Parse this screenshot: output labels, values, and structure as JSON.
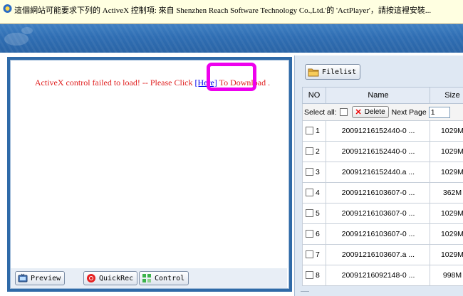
{
  "infobar": {
    "message": "這個網站可能要求下列的 ActiveX 控制項: 來自 Shenzhen Reach Software Technology Co.,Ltd.'的 'ActPlayer'，請按這裡安裝..."
  },
  "player": {
    "msg_before": "ActiveX control failed to load! -- Please Click ",
    "here_label": "[Here]",
    "msg_after": " To Download ."
  },
  "toolbar": {
    "preview_label": "Preview",
    "quickrec_label": "QuickRec",
    "control_label": "Control"
  },
  "filelist": {
    "button_label": "Filelist",
    "columns": [
      "NO",
      "Name",
      "Size"
    ],
    "select_all_label": "Select all:",
    "delete_label": "Delete",
    "next_page_label": "Next Page",
    "page_value": "1",
    "rows": [
      {
        "no": "1",
        "name": "20091216152440-0 ...",
        "size": "1029M"
      },
      {
        "no": "2",
        "name": "20091216152440-0 ...",
        "size": "1029M"
      },
      {
        "no": "3",
        "name": "20091216152440.a ...",
        "size": "1029M"
      },
      {
        "no": "4",
        "name": "20091216103607-0 ...",
        "size": "362M"
      },
      {
        "no": "5",
        "name": "20091216103607-0 ...",
        "size": "1029M"
      },
      {
        "no": "6",
        "name": "20091216103607-0 ...",
        "size": "1029M"
      },
      {
        "no": "7",
        "name": "20091216103607.a ...",
        "size": "1029M"
      },
      {
        "no": "8",
        "name": "20091216092148-0 ...",
        "size": "998M"
      }
    ]
  },
  "colors": {
    "highlight": "#ee00ee",
    "error_text": "#e02020",
    "frame_blue": "#2f6aa8"
  }
}
